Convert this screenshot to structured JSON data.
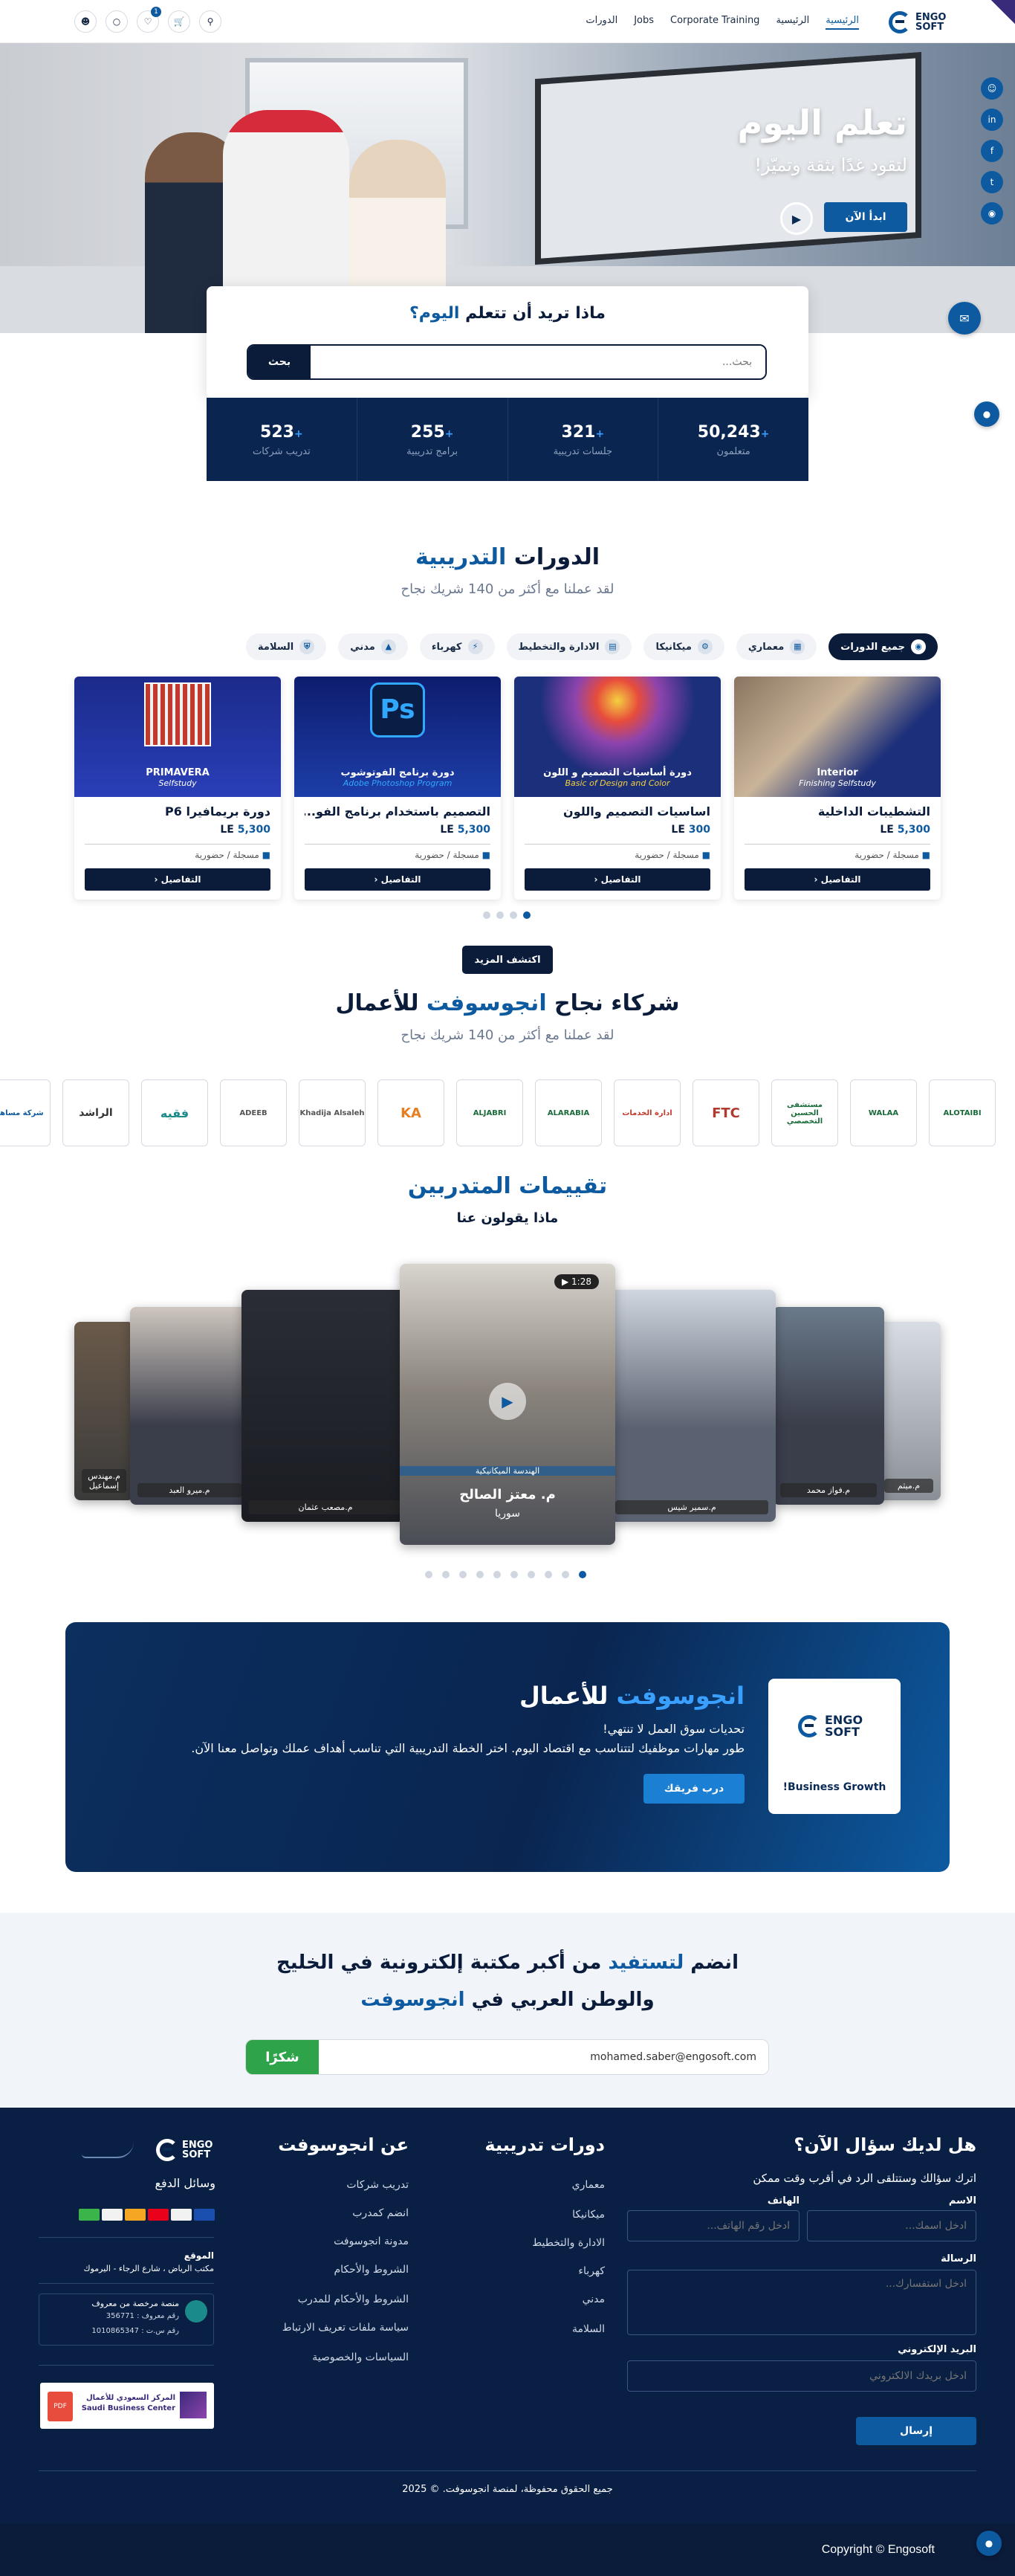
{
  "header": {
    "logo_text": "ENGO SOFT",
    "nav": [
      "الرئيسية",
      "الرئيسية",
      "Corporate Training",
      "Jobs",
      "الدورات"
    ],
    "cart_count": "1"
  },
  "hero": {
    "title": "تعلم اليوم",
    "subtitle": "لتقود غدًا بثقة وتميّز!",
    "cta": "ابدأ الآن"
  },
  "search": {
    "title_a": "ماذا تريد أن تتعلم ",
    "title_b": "اليوم؟",
    "placeholder": "بحث...",
    "button": "بحث"
  },
  "stats": [
    {
      "value": "50,243",
      "label": "متعلمون"
    },
    {
      "value": "321",
      "label": "جلسات تدريبية"
    },
    {
      "value": "255",
      "label": "برامج تدريبية"
    },
    {
      "value": "523",
      "label": "تدريب شركات"
    }
  ],
  "courses_section": {
    "title_a": "الدورات ",
    "title_b": "التدريبية",
    "subtitle": "لقد عملنا مع أكثر من 140 شريك نجاح"
  },
  "filters": [
    "جميع الدورات",
    "معماري",
    "ميكانيكا",
    "الادارة والتخطيط",
    "كهرباء",
    "مدني",
    "السلامة"
  ],
  "courses": [
    {
      "title": "التشطيبات الداخلية",
      "price": "5,300",
      "currency": "LE",
      "mode": "مسجلة / حضورية",
      "thumb_l1": "Interior",
      "thumb_l2": "Finishing Selfstudy",
      "btn": "التفاصيل"
    },
    {
      "title": "اساسيات التصميم واللون",
      "price": "300",
      "currency": "LE",
      "mode": "مسجلة / حضورية",
      "thumb_l1": "دورة أساسيات التصميم و اللون",
      "thumb_l2": "Basic of Design and Color",
      "btn": "التفاصيل"
    },
    {
      "title": "التصميم باستخدام برنامج الفو...",
      "price": "5,300",
      "currency": "LE",
      "mode": "مسجلة / حضورية",
      "thumb_l1": "دورة برنامج الفوتوشوب",
      "thumb_l2": "Adobe Photoshop Program",
      "btn": "التفاصيل"
    },
    {
      "title": "دورة بريمافيرا P6",
      "price": "5,300",
      "currency": "LE",
      "mode": "مسجلة / حضورية",
      "thumb_l1": "PRIMAVERA",
      "thumb_l2": "Selfstudy",
      "btn": "التفاصيل"
    }
  ],
  "more_button": "اكتشف المزيد",
  "partners_section": {
    "title_a": "شركاء نجاح ",
    "title_b": "انجوسوفت",
    "title_c": " للأعمال",
    "subtitle": "لقد عملنا مع أكثر من 140 شريك نجاح"
  },
  "partners": [
    "ALOTAIBI",
    "WALAA",
    "مستشفى الحسين التخصصي",
    "FTC",
    "ادارة الخدمات",
    "ALARABIA",
    "ALJABRI",
    "KA",
    "Khadija Alsaleh",
    "ADEEB",
    "فقيه",
    "الراشد",
    "شركة مساهمة"
  ],
  "reviews": {
    "title": "تقييمات المتدربين",
    "subtitle": "ماذا يقولون عنا",
    "featured_name": "م. معتز الصالح",
    "featured_country": "سوريا",
    "featured_tag": "الهندسة الميكانيكية",
    "featured_duration": "1:28",
    "names": [
      "م.ميثم",
      "م.فواز محمد",
      "م.سمير شيس",
      "م.مصعب عثمان",
      "م.ميرو العبد",
      "م.مهندس إسماعيل"
    ]
  },
  "business": {
    "title_a": "انجوسوفت",
    "title_b": " للأعمال",
    "line1": "تحديات سوق العمل لا تنتهي!",
    "line2": "طور مهارات موظفيك لتتناسب مع اقتصاد اليوم. اختر الخطة التدريبية التي تناسب أهداف عملك وتواصل معنا الآن.",
    "button": "درب فريقك",
    "logo_text": "ENGO SOFT",
    "logo_caption": "Business Growth!"
  },
  "newsletter": {
    "line1_a": "انضم ",
    "line1_b": "لتستفيد",
    "line1_c": " من أكبر مكتبة إلكترونية في الخليج",
    "line2_a": "والوطن العربي في ",
    "line2_b": "انجوسوفت",
    "email": "mohamed.saber@engosoft.com",
    "button": "شكرًا"
  },
  "footer": {
    "contact_title": "هل لديك سؤال الآن؟",
    "contact_sub": "اترك سؤالك وستتلقى الرد في أقرب وقت ممكن",
    "name_label": "الاسم",
    "name_ph": "ادخل اسمك...",
    "phone_label": "الهاتف",
    "phone_ph": "ادخل رقم الهاتف...",
    "msg_label": "الرسالة",
    "msg_ph": "ادخل استفسارك...",
    "email_label": "البريد الإلكتروني",
    "email_ph": "ادخل بريدك الالكتروني",
    "send": "إرسال",
    "courses_title": "دورات تدريبية",
    "courses_links": [
      "معماري",
      "ميكانيكا",
      "الادارة والتخطيط",
      "كهرباء",
      "مدني",
      "السلامة"
    ],
    "about_title": "عن انجوسوفت",
    "about_links": [
      "تدريب شركات",
      "انضم كمدرب",
      "مدونة انجوسوفت",
      "الشروط والأحكام",
      "الشروط والأحكام للمدرب",
      "سياسة ملفات تعريف الارتباط",
      "السياسات والخصوصية"
    ],
    "payment_title": "وسائل الدفع",
    "location_label": "الموقع",
    "location": "مكتب الرياض ، شارع الرجاء - اليرموك",
    "licensed": "منصة مرخصة من معروف",
    "reg_no": "رقم معروف : 356771",
    "cr_no": "رقم س.ت : 1010865347",
    "sbc": "المركز السعودي للأعمال Saudi Business Center",
    "rights": "جميع الحقوق محفوظة، لمنصة انجوسوفت. © 2025",
    "copyright": "Copyright © Engosoft"
  }
}
